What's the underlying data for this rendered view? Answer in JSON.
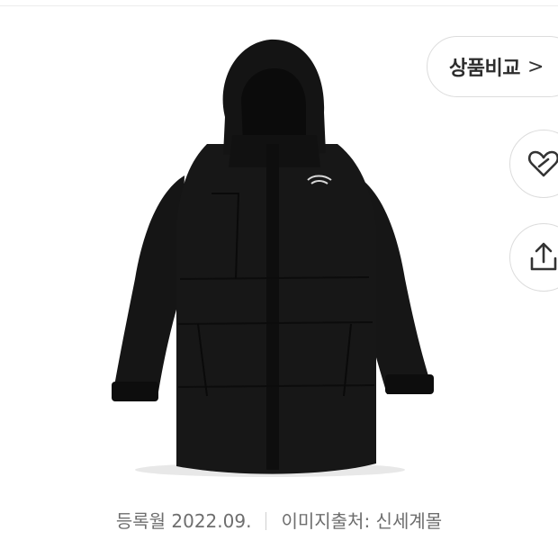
{
  "product": {
    "image_alt": "black long hooded down parka",
    "brand_logo_icon": "the-north-face-logo"
  },
  "actions": {
    "compare_label": "상품비교",
    "compare_chevron": ">",
    "wishlist_icon": "heart-link-icon",
    "share_icon": "share-icon"
  },
  "meta": {
    "registered": "등록월 2022.09.",
    "image_source": "이미지출처: 신세계몰"
  },
  "colors": {
    "jacket": "#141414",
    "border": "#dcdcdc",
    "meta_text": "#6e6e6e"
  }
}
